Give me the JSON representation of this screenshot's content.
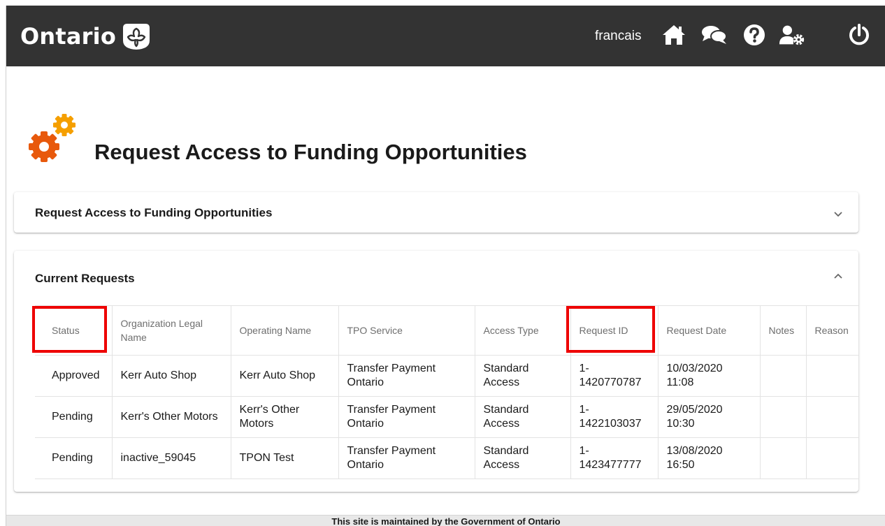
{
  "header": {
    "brand": "Ontario",
    "language_link": "francais",
    "icons": [
      "home-icon",
      "chat-icon",
      "help-icon",
      "user-settings-icon",
      "power-icon"
    ]
  },
  "page": {
    "title": "Request Access to Funding Opportunities"
  },
  "panels": {
    "request_access": {
      "title": "Request Access to Funding Opportunities",
      "expanded": false
    },
    "current_requests": {
      "title": "Current Requests",
      "expanded": true,
      "columns": [
        "Status",
        "Organization Legal Name",
        "Operating Name",
        "TPO Service",
        "Access Type",
        "Request ID",
        "Request Date",
        "Notes",
        "Reason"
      ],
      "rows": [
        {
          "status": "Approved",
          "org_legal_name": "Kerr Auto Shop",
          "operating_name": "Kerr Auto Shop",
          "tpo_service": "Transfer Payment Ontario",
          "access_type": "Standard Access",
          "request_id": "1-1420770787",
          "request_date": "10/03/2020 11:08",
          "notes": "",
          "reason": ""
        },
        {
          "status": "Pending",
          "org_legal_name": "Kerr's Other Motors",
          "operating_name": "Kerr's Other Motors",
          "tpo_service": "Transfer Payment Ontario",
          "access_type": "Standard Access",
          "request_id": "1-1422103037",
          "request_date": "29/05/2020 10:30",
          "notes": "",
          "reason": ""
        },
        {
          "status": "Pending",
          "org_legal_name": "inactive_59045",
          "operating_name": "TPON Test",
          "tpo_service": "Transfer Payment Ontario",
          "access_type": "Standard Access",
          "request_id": "1-1423477777",
          "request_date": "13/08/2020 16:50",
          "notes": "",
          "reason": ""
        }
      ],
      "highlighted_columns": [
        "Status",
        "Request ID"
      ]
    }
  },
  "footer": {
    "text": "This site is maintained by the Government of Ontario"
  },
  "colors": {
    "header_bg": "#333333",
    "gear_orange": "#e8590c",
    "gear_yellow": "#f59f00",
    "highlight": "#ee0000"
  }
}
